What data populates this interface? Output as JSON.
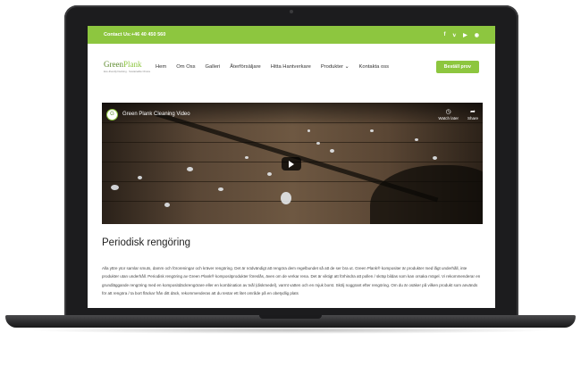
{
  "topbar": {
    "contact": "Contact Us:+46 40 450 560",
    "social_icons": [
      "facebook-icon",
      "twitter-icon",
      "youtube-icon",
      "instagram-icon"
    ]
  },
  "logo": {
    "name_part1": "Green",
    "name_part2": "Plank",
    "tagline": "Eco-friendly Decking · Sustainable Choice"
  },
  "nav": {
    "items": [
      "Hem",
      "Om Oss",
      "Galleri",
      "Återförsäljare",
      "Hitta Hantverkare",
      "Produkter",
      "Kontakta oss"
    ],
    "cta": "Beställ prov"
  },
  "video": {
    "title": "Green Plank Cleaning Video",
    "watch_later": "Watch later",
    "share": "Share"
  },
  "content": {
    "heading": "Periodisk rengöring",
    "paragraph": "Alla yttre ytor samlar smuts, damm och föroreningar och kräver rengöring. Det är nödvändigt att rengöra dem regelbundet så att de ser bra ut. Green Plank® kompositer är produkter med lågt underhåll, inte produkter utan underhåll. Periodisk rengöring av Green Plank® kompositprodukter föreslås, även om de verkar rena. Det är viktigt att förhindra att pollen / skräp bildas som kan orsaka mögel. Vi rekommenderar en grundläggande rengöring med en kompositdäckrengörare eller en kombination av tvål (diskmedel), varmt vatten och en mjuk borst. Skölj noggrant efter rengöring. Om du är osäker på vilken produkt som används för att rengöra / ta bort fläckar från ditt däck, rekommenderas att du testar ett litet område på en obetydlig plats"
  },
  "colors": {
    "brand_green": "#8dc63f",
    "dark_green": "#5d8a2d"
  }
}
